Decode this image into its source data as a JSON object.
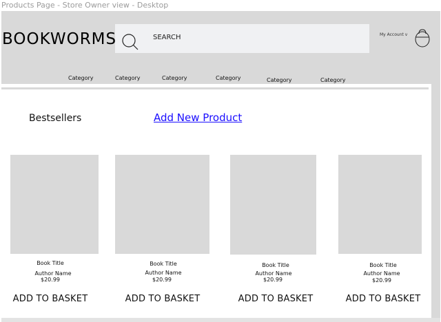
{
  "frame_label": "Products Page - Store Owner view - Desktop",
  "header": {
    "logo": "BOOKWORMS",
    "search_placeholder": "SEARCH",
    "account_label": "My Account v",
    "categories": [
      "Category",
      "Category",
      "Category",
      "Category",
      "Category",
      "Category"
    ]
  },
  "main": {
    "section_title": "Bestsellers",
    "add_product_link": "Add New Product",
    "products": [
      {
        "title": "Book Title",
        "author": "Author Name",
        "price": "$20.99",
        "button": "ADD TO BASKET"
      },
      {
        "title": "Book Title",
        "author": "Author Name",
        "price": "$20.99",
        "button": "ADD TO BASKET"
      },
      {
        "title": "Book Title",
        "author": "Author Name",
        "price": "$20.99",
        "button": "ADD TO BASKET"
      },
      {
        "title": "Book Title",
        "author": "Author Name",
        "price": "$20.99",
        "button": "ADD TO BASKET"
      }
    ]
  },
  "colors": {
    "header_bg": "#d9d9d9",
    "search_bg": "#f0f1f3",
    "link": "#1a0dff",
    "placeholder_image": "#d9d9d9"
  }
}
